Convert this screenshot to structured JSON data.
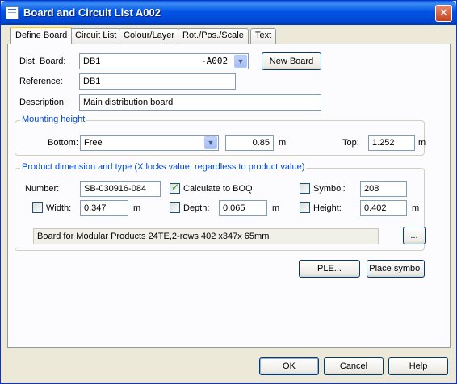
{
  "window": {
    "title": "Board and Circuit List A002"
  },
  "tabs": [
    {
      "label": "Define Board"
    },
    {
      "label": "Circuit List"
    },
    {
      "label": "Colour/Layer"
    },
    {
      "label": "Rot./Pos./Scale"
    },
    {
      "label": "Text"
    }
  ],
  "board": {
    "dist_board_label": "Dist. Board:",
    "dist_board_value": "DB1",
    "dist_board_suffix": "-A002",
    "new_board_button": "New Board",
    "reference_label": "Reference:",
    "reference_value": "DB1",
    "description_label": "Description:",
    "description_value": "Main distribution board"
  },
  "mounting": {
    "group_title": "Mounting height",
    "bottom_label": "Bottom:",
    "bottom_select": "Free",
    "height_value": "0.85",
    "unit_1": "m",
    "top_label": "Top:",
    "top_value": "1.252",
    "unit_2": "m"
  },
  "product": {
    "group_title": "Product dimension and type (X locks value, regardless to product value)",
    "number_label": "Number:",
    "number_value": "SB-030916-084",
    "calc_boq_label": "Calculate to BOQ",
    "calc_boq_checked": true,
    "symbol_label": "Symbol:",
    "symbol_value": "208",
    "width_label": "Width:",
    "width_value": "0.347",
    "width_unit": "m",
    "depth_label": "Depth:",
    "depth_value": "0.065",
    "depth_unit": "m",
    "height_label": "Height:",
    "height_value": "0.402",
    "height_unit": "m",
    "description_value": "Board for Modular Products  24TE,2-rows 402 x347x 65mm",
    "browse_button": "..."
  },
  "actions": {
    "ple_button": "PLE...",
    "place_symbol_button": "Place symbol"
  },
  "footer": {
    "ok": "OK",
    "cancel": "Cancel",
    "help": "Help"
  }
}
